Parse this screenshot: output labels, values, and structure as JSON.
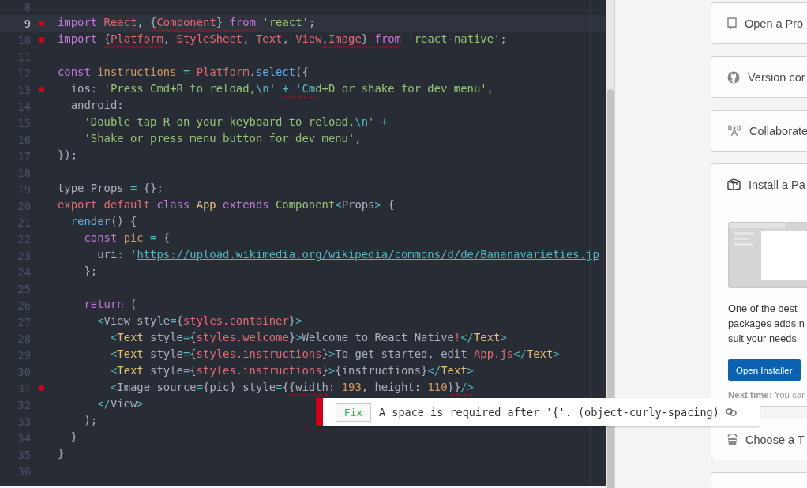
{
  "editor": {
    "lines": [
      {
        "number": "8",
        "current": false,
        "marker": false
      },
      {
        "number": "9",
        "current": true,
        "marker": true,
        "tokens": [
          {
            "text": "import",
            "kind": "keyword",
            "lint": false
          },
          {
            "text": " React",
            "kind": "variable",
            "lint": false
          },
          {
            "text": ", ",
            "kind": "plain",
            "lint": false
          },
          {
            "text": "{",
            "kind": "plain",
            "lint": true
          },
          {
            "text": "Component",
            "kind": "variable",
            "lint": true
          },
          {
            "text": "}",
            "kind": "plain",
            "lint": true
          },
          {
            "text": " from",
            "kind": "keyword",
            "lint": true
          },
          {
            "text": " 'react'",
            "kind": "string",
            "lint": false
          },
          {
            "text": ";",
            "kind": "plain",
            "lint": false
          }
        ]
      },
      {
        "number": "10",
        "current": false,
        "marker": true,
        "tokens": [
          {
            "text": "import ",
            "kind": "keyword",
            "lint": false
          },
          {
            "text": "{",
            "kind": "plain",
            "lint": true
          },
          {
            "text": "Platform",
            "kind": "variable",
            "lint": true
          },
          {
            "text": ", ",
            "kind": "plain",
            "lint": false
          },
          {
            "text": "StyleSheet",
            "kind": "variable",
            "lint": false
          },
          {
            "text": ", ",
            "kind": "plain",
            "lint": false
          },
          {
            "text": "Text",
            "kind": "variable",
            "lint": false
          },
          {
            "text": ", ",
            "kind": "plain",
            "lint": false
          },
          {
            "text": "Vi",
            "kind": "variable",
            "lint": false
          },
          {
            "text": "ew",
            "kind": "variable",
            "lint": false
          },
          {
            "text": ",",
            "kind": "plain",
            "lint": true
          },
          {
            "text": "Image",
            "kind": "variable",
            "lint": true
          },
          {
            "text": "}",
            "kind": "plain",
            "lint": true
          },
          {
            "text": " from",
            "kind": "keyword",
            "lint": true
          },
          {
            "text": " 'react-native'",
            "kind": "string",
            "lint": false
          },
          {
            "text": ";",
            "kind": "plain",
            "lint": false
          }
        ]
      },
      {
        "number": "11",
        "current": false,
        "marker": false
      },
      {
        "number": "12",
        "current": false,
        "marker": false,
        "tokens": [
          {
            "text": "const",
            "kind": "keyword",
            "lint": false
          },
          {
            "text": " instructions",
            "kind": "constant",
            "lint": false
          },
          {
            "text": " = ",
            "kind": "operator",
            "lint": false
          },
          {
            "text": "Platform",
            "kind": "variable",
            "lint": false
          },
          {
            "text": ".",
            "kind": "plain",
            "lint": false
          },
          {
            "text": "select",
            "kind": "function",
            "lint": false
          },
          {
            "text": "({",
            "kind": "plain",
            "lint": false
          }
        ]
      },
      {
        "number": "13",
        "current": false,
        "marker": true,
        "tokens": [
          {
            "text": "  ios: ",
            "kind": "plain",
            "lint": false
          },
          {
            "text": "'Press Cmd+R to reload,",
            "kind": "string",
            "lint": false
          },
          {
            "text": "\\n",
            "kind": "operator",
            "lint": false
          },
          {
            "text": "' ",
            "kind": "string",
            "lint": false
          },
          {
            "text": "+ 'Cm",
            "kind": "operator",
            "lint": true
          },
          {
            "text": "d+D or shake for dev menu'",
            "kind": "string",
            "lint": false
          },
          {
            "text": ",",
            "kind": "plain",
            "lint": false
          }
        ]
      },
      {
        "number": "14",
        "current": false,
        "marker": false,
        "tokens": [
          {
            "text": "  android:",
            "kind": "plain",
            "lint": false
          }
        ]
      },
      {
        "number": "15",
        "current": false,
        "marker": false,
        "tokens": [
          {
            "text": "    'Double tap R on your keyboard to reload,",
            "kind": "string",
            "lint": false
          },
          {
            "text": "\\n",
            "kind": "operator",
            "lint": false
          },
          {
            "text": "'",
            "kind": "string",
            "lint": false
          },
          {
            "text": " +",
            "kind": "operator",
            "lint": false
          }
        ]
      },
      {
        "number": "16",
        "current": false,
        "marker": false,
        "tokens": [
          {
            "text": "    'Shake or press menu button for dev menu'",
            "kind": "string",
            "lint": false
          },
          {
            "text": ",",
            "kind": "plain",
            "lint": false
          }
        ]
      },
      {
        "number": "17",
        "current": false,
        "marker": false,
        "tokens": [
          {
            "text": "});",
            "kind": "plain",
            "lint": false
          }
        ]
      },
      {
        "number": "18",
        "current": false,
        "marker": false
      },
      {
        "number": "19",
        "current": false,
        "marker": false,
        "tokens": [
          {
            "text": "type Props",
            "kind": "plain",
            "lint": false
          },
          {
            "text": " = ",
            "kind": "operator",
            "lint": false
          },
          {
            "text": "{};",
            "kind": "plain",
            "lint": false
          }
        ]
      },
      {
        "number": "20",
        "current": false,
        "marker": false,
        "tokens": [
          {
            "text": "export default",
            "kind": "variable",
            "lint": false
          },
          {
            "text": " class",
            "kind": "keyword",
            "lint": false
          },
          {
            "text": " App",
            "kind": "class",
            "lint": false
          },
          {
            "text": " extends",
            "kind": "keyword",
            "lint": false
          },
          {
            "text": " Component",
            "kind": "string",
            "lint": false
          },
          {
            "text": "<",
            "kind": "operator",
            "lint": false
          },
          {
            "text": "Props",
            "kind": "plain",
            "lint": false
          },
          {
            "text": ">",
            "kind": "operator",
            "lint": false
          },
          {
            "text": " {",
            "kind": "plain",
            "lint": false
          }
        ]
      },
      {
        "number": "21",
        "current": false,
        "marker": false,
        "tokens": [
          {
            "text": "  render",
            "kind": "function",
            "lint": false
          },
          {
            "text": "() {",
            "kind": "plain",
            "lint": false
          }
        ]
      },
      {
        "number": "22",
        "current": false,
        "marker": false,
        "tokens": [
          {
            "text": "    const",
            "kind": "keyword",
            "lint": false
          },
          {
            "text": " pic",
            "kind": "constant",
            "lint": false
          },
          {
            "text": " = ",
            "kind": "operator",
            "lint": false
          },
          {
            "text": "{",
            "kind": "plain",
            "lint": false
          }
        ]
      },
      {
        "number": "23",
        "current": false,
        "marker": false,
        "tokens": [
          {
            "text": "      uri: ",
            "kind": "plain",
            "lint": false
          },
          {
            "text": "'",
            "kind": "string",
            "lint": false
          },
          {
            "text": "https://upload.wikimedia.org/wikipedia/commons/d/de/Bananavarieties.jp",
            "kind": "link",
            "lint": false
          }
        ]
      },
      {
        "number": "24",
        "current": false,
        "marker": false,
        "tokens": [
          {
            "text": "    };",
            "kind": "plain",
            "lint": false
          }
        ]
      },
      {
        "number": "25",
        "current": false,
        "marker": false
      },
      {
        "number": "26",
        "current": false,
        "marker": false,
        "tokens": [
          {
            "text": "    return",
            "kind": "keyword",
            "lint": false
          },
          {
            "text": " (",
            "kind": "plain",
            "lint": false
          }
        ]
      },
      {
        "number": "27",
        "current": false,
        "marker": false,
        "tokens": [
          {
            "text": "      <",
            "kind": "operator",
            "lint": false
          },
          {
            "text": "View style",
            "kind": "plain",
            "lint": false
          },
          {
            "text": "=",
            "kind": "operator",
            "lint": false
          },
          {
            "text": "{",
            "kind": "plain",
            "lint": false
          },
          {
            "text": "styles.container",
            "kind": "variable",
            "lint": false
          },
          {
            "text": "}",
            "kind": "plain",
            "lint": false
          },
          {
            "text": ">",
            "kind": "operator",
            "lint": false
          }
        ]
      },
      {
        "number": "28",
        "current": false,
        "marker": false,
        "tokens": [
          {
            "text": "        <",
            "kind": "operator",
            "lint": false
          },
          {
            "text": "Text",
            "kind": "class",
            "lint": false
          },
          {
            "text": " style",
            "kind": "plain",
            "lint": false
          },
          {
            "text": "=",
            "kind": "operator",
            "lint": false
          },
          {
            "text": "{",
            "kind": "plain",
            "lint": false
          },
          {
            "text": "styles.welcome",
            "kind": "variable",
            "lint": false
          },
          {
            "text": "}",
            "kind": "plain",
            "lint": false
          },
          {
            "text": ">",
            "kind": "operator",
            "lint": false
          },
          {
            "text": "Welcome to React Native",
            "kind": "plain",
            "lint": false
          },
          {
            "text": "!",
            "kind": "variable",
            "lint": false
          },
          {
            "text": "</",
            "kind": "operator",
            "lint": false
          },
          {
            "text": "Text",
            "kind": "class",
            "lint": false
          },
          {
            "text": ">",
            "kind": "operator",
            "lint": false
          }
        ]
      },
      {
        "number": "29",
        "current": false,
        "marker": false,
        "tokens": [
          {
            "text": "        <",
            "kind": "operator",
            "lint": false
          },
          {
            "text": "Text",
            "kind": "class",
            "lint": false
          },
          {
            "text": " style",
            "kind": "plain",
            "lint": false
          },
          {
            "text": "=",
            "kind": "operator",
            "lint": false
          },
          {
            "text": "{",
            "kind": "plain",
            "lint": false
          },
          {
            "text": "styles.instructions",
            "kind": "variable",
            "lint": false
          },
          {
            "text": "}",
            "kind": "plain",
            "lint": false
          },
          {
            "text": ">",
            "kind": "operator",
            "lint": false
          },
          {
            "text": "To get started, edit ",
            "kind": "plain",
            "lint": false
          },
          {
            "text": "App.js",
            "kind": "variable",
            "lint": false
          },
          {
            "text": "</",
            "kind": "operator",
            "lint": false
          },
          {
            "text": "Text",
            "kind": "class",
            "lint": false
          },
          {
            "text": ">",
            "kind": "operator",
            "lint": false
          }
        ]
      },
      {
        "number": "30",
        "current": false,
        "marker": false,
        "tokens": [
          {
            "text": "        <",
            "kind": "operator",
            "lint": false
          },
          {
            "text": "Text",
            "kind": "class",
            "lint": false
          },
          {
            "text": " style",
            "kind": "plain",
            "lint": false
          },
          {
            "text": "=",
            "kind": "operator",
            "lint": false
          },
          {
            "text": "{",
            "kind": "plain",
            "lint": false
          },
          {
            "text": "styles.instructions",
            "kind": "variable",
            "lint": false
          },
          {
            "text": "}",
            "kind": "plain",
            "lint": false
          },
          {
            "text": ">",
            "kind": "operator",
            "lint": false
          },
          {
            "text": "{instructions}",
            "kind": "plain",
            "lint": false
          },
          {
            "text": "</",
            "kind": "operator",
            "lint": false
          },
          {
            "text": "Text",
            "kind": "class",
            "lint": false
          },
          {
            "text": ">",
            "kind": "operator",
            "lint": false
          }
        ]
      },
      {
        "number": "31",
        "current": false,
        "marker": true,
        "tokens": [
          {
            "text": "        <",
            "kind": "operator",
            "lint": false
          },
          {
            "text": "Image source",
            "kind": "plain",
            "lint": false
          },
          {
            "text": "=",
            "kind": "operator",
            "lint": false
          },
          {
            "text": "{pic} style",
            "kind": "plain",
            "lint": false
          },
          {
            "text": "=",
            "kind": "operator",
            "lint": false
          },
          {
            "text": "{",
            "kind": "plain",
            "lint": false
          },
          {
            "text": "{width",
            "kind": "plain",
            "lint": true
          },
          {
            "text": ":",
            "kind": "plain",
            "lint": false
          },
          {
            "text": " 193",
            "kind": "number",
            "lint": false
          },
          {
            "text": ", height: ",
            "kind": "plain",
            "lint": false
          },
          {
            "text": "110",
            "kind": "number",
            "lint": false
          },
          {
            "text": "}}",
            "kind": "plain",
            "lint": true
          },
          {
            "text": "/>",
            "kind": "operator",
            "lint": true
          }
        ]
      },
      {
        "number": "32",
        "current": false,
        "marker": false,
        "tokens": [
          {
            "text": "      </",
            "kind": "operator",
            "lint": false
          },
          {
            "text": "View",
            "kind": "plain",
            "lint": false
          },
          {
            "text": ">",
            "kind": "operator",
            "lint": false
          }
        ]
      },
      {
        "number": "33",
        "current": false,
        "marker": false,
        "tokens": [
          {
            "text": "    );",
            "kind": "plain",
            "lint": false
          }
        ]
      },
      {
        "number": "34",
        "current": false,
        "marker": false,
        "tokens": [
          {
            "text": "  }",
            "kind": "plain",
            "lint": false
          }
        ]
      },
      {
        "number": "35",
        "current": false,
        "marker": false,
        "tokens": [
          {
            "text": "}",
            "kind": "plain",
            "lint": false
          }
        ]
      },
      {
        "number": "36",
        "current": false,
        "marker": false
      }
    ]
  },
  "lint_message": {
    "fix_label": "Fix",
    "message": "A space is required after '{'. (object-curly-spacing)"
  },
  "guide": {
    "cards": [
      {
        "title": "Open a Pro",
        "expanded": false
      },
      {
        "title": "Version cor",
        "expanded": false
      },
      {
        "title": "Collaborate",
        "expanded": false
      },
      {
        "title": "Install a Pa",
        "expanded": true,
        "body_lines": [
          "One of the best",
          "packages adds n",
          "suit your needs."
        ],
        "button": "Open Installer",
        "note": "**Next time:** You car"
      },
      {
        "title": "Choose a T",
        "expanded": false
      }
    ]
  }
}
